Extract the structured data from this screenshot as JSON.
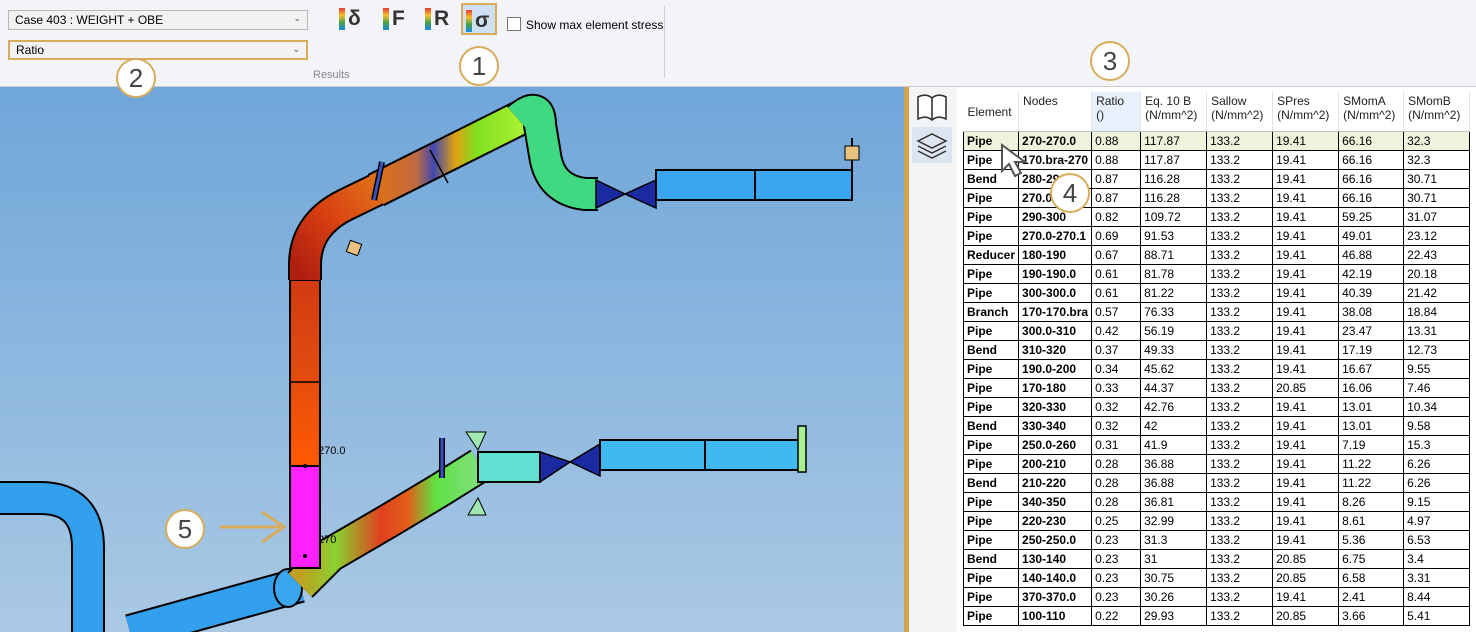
{
  "ribbon": {
    "case_select": "Case 403 : WEIGHT + OBE",
    "result_type_select": "Ratio",
    "group_label": "Results",
    "buttons": [
      {
        "symbol": "δ",
        "icon": "displacement-icon"
      },
      {
        "symbol": "F",
        "icon": "force-icon"
      },
      {
        "symbol": "R",
        "icon": "reaction-icon"
      },
      {
        "symbol": "σ",
        "icon": "stress-icon"
      }
    ],
    "show_max_label": "Show max element stress"
  },
  "callouts": [
    "1",
    "2",
    "3",
    "4",
    "5"
  ],
  "model": {
    "node_labels": [
      "270.0",
      "270"
    ],
    "colors": {
      "highlight": "#ff22ff",
      "low": "#3aa0ee",
      "high": "#cc2200"
    }
  },
  "table": {
    "columns": [
      {
        "line1": "Element",
        "line2": ""
      },
      {
        "line1": "Nodes",
        "line2": ""
      },
      {
        "line1": "Ratio",
        "line2": "()"
      },
      {
        "line1": "Eq. 10 B",
        "line2": "(N/mm^2)"
      },
      {
        "line1": "Sallow",
        "line2": "(N/mm^2)"
      },
      {
        "line1": "SPres",
        "line2": "(N/mm^2)"
      },
      {
        "line1": "SMomA",
        "line2": "(N/mm^2)"
      },
      {
        "line1": "SMomB",
        "line2": "(N/mm^2)"
      }
    ],
    "rows": [
      [
        "Pipe",
        "270-270.0",
        "0.88",
        "117.87",
        "133.2",
        "19.41",
        "66.16",
        "32.3"
      ],
      [
        "Pipe",
        "170.bra-270",
        "0.88",
        "117.87",
        "133.2",
        "19.41",
        "66.16",
        "32.3"
      ],
      [
        "Bend",
        "280-290",
        "0.87",
        "116.28",
        "133.2",
        "19.41",
        "66.16",
        "30.71"
      ],
      [
        "Pipe",
        "270.0-280",
        "0.87",
        "116.28",
        "133.2",
        "19.41",
        "66.16",
        "30.71"
      ],
      [
        "Pipe",
        "290-300",
        "0.82",
        "109.72",
        "133.2",
        "19.41",
        "59.25",
        "31.07"
      ],
      [
        "Pipe",
        "270.0-270.1",
        "0.69",
        "91.53",
        "133.2",
        "19.41",
        "49.01",
        "23.12"
      ],
      [
        "Reducer",
        "180-190",
        "0.67",
        "88.71",
        "133.2",
        "19.41",
        "46.88",
        "22.43"
      ],
      [
        "Pipe",
        "190-190.0",
        "0.61",
        "81.78",
        "133.2",
        "19.41",
        "42.19",
        "20.18"
      ],
      [
        "Pipe",
        "300-300.0",
        "0.61",
        "81.22",
        "133.2",
        "19.41",
        "40.39",
        "21.42"
      ],
      [
        "Branch",
        "170-170.bra",
        "0.57",
        "76.33",
        "133.2",
        "19.41",
        "38.08",
        "18.84"
      ],
      [
        "Pipe",
        "300.0-310",
        "0.42",
        "56.19",
        "133.2",
        "19.41",
        "23.47",
        "13.31"
      ],
      [
        "Bend",
        "310-320",
        "0.37",
        "49.33",
        "133.2",
        "19.41",
        "17.19",
        "12.73"
      ],
      [
        "Pipe",
        "190.0-200",
        "0.34",
        "45.62",
        "133.2",
        "19.41",
        "16.67",
        "9.55"
      ],
      [
        "Pipe",
        "170-180",
        "0.33",
        "44.37",
        "133.2",
        "20.85",
        "16.06",
        "7.46"
      ],
      [
        "Pipe",
        "320-330",
        "0.32",
        "42.76",
        "133.2",
        "19.41",
        "13.01",
        "10.34"
      ],
      [
        "Bend",
        "330-340",
        "0.32",
        "42",
        "133.2",
        "19.41",
        "13.01",
        "9.58"
      ],
      [
        "Pipe",
        "250.0-260",
        "0.31",
        "41.9",
        "133.2",
        "19.41",
        "7.19",
        "15.3"
      ],
      [
        "Pipe",
        "200-210",
        "0.28",
        "36.88",
        "133.2",
        "19.41",
        "11.22",
        "6.26"
      ],
      [
        "Bend",
        "210-220",
        "0.28",
        "36.88",
        "133.2",
        "19.41",
        "11.22",
        "6.26"
      ],
      [
        "Pipe",
        "340-350",
        "0.28",
        "36.81",
        "133.2",
        "19.41",
        "8.26",
        "9.15"
      ],
      [
        "Pipe",
        "220-230",
        "0.25",
        "32.99",
        "133.2",
        "19.41",
        "8.61",
        "4.97"
      ],
      [
        "Pipe",
        "250-250.0",
        "0.23",
        "31.3",
        "133.2",
        "19.41",
        "5.36",
        "6.53"
      ],
      [
        "Bend",
        "130-140",
        "0.23",
        "31",
        "133.2",
        "20.85",
        "6.75",
        "3.4"
      ],
      [
        "Pipe",
        "140-140.0",
        "0.23",
        "30.75",
        "133.2",
        "20.85",
        "6.58",
        "3.31"
      ],
      [
        "Pipe",
        "370-370.0",
        "0.23",
        "30.26",
        "133.2",
        "19.41",
        "2.41",
        "8.44"
      ],
      [
        "Pipe",
        "100-110",
        "0.22",
        "29.93",
        "133.2",
        "20.85",
        "3.66",
        "5.41"
      ]
    ]
  }
}
